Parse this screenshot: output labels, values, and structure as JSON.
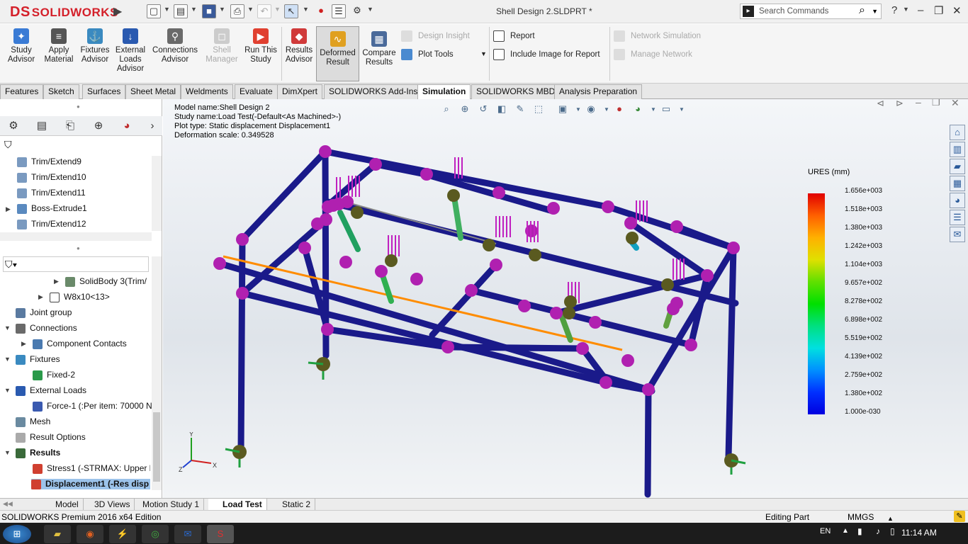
{
  "app": {
    "brand": "SOLIDWORKS",
    "brand_prefix": "DS",
    "window_title": "Shell Design 2.SLDPRT *",
    "search_placeholder": "Search Commands",
    "help_label": "?"
  },
  "commands": [
    {
      "label": "Study\nAdvisor",
      "icon": "study-advisor-icon",
      "color": "#3a7bd5"
    },
    {
      "label": "Apply\nMaterial",
      "icon": "apply-material-icon",
      "color": "#555555"
    },
    {
      "label": "Fixtures\nAdvisor",
      "icon": "fixtures-advisor-icon",
      "color": "#3a8ac0"
    },
    {
      "label": "External\nLoads\nAdvisor",
      "icon": "external-loads-icon",
      "color": "#2a5ab0"
    },
    {
      "label": "Connections\nAdvisor",
      "icon": "connections-advisor-icon",
      "color": "#6a6a6a"
    },
    {
      "label": "Shell\nManager",
      "icon": "shell-manager-icon",
      "color": "#cccccc",
      "disabled": true
    },
    {
      "label": "Run This\nStudy",
      "icon": "run-study-icon",
      "color": "#e04030"
    },
    {
      "label": "Results\nAdvisor",
      "icon": "results-advisor-icon",
      "color": "#d03a3a"
    },
    {
      "label": "Deformed\nResult",
      "icon": "deformed-result-icon",
      "color": "#e0a020"
    },
    {
      "label": "Compare\nResults",
      "icon": "compare-results-icon",
      "color": "#4a6a9a"
    }
  ],
  "side_commands": {
    "design_insight": "Design Insight",
    "plot_tools": "Plot Tools",
    "report": "Report",
    "include_image": "Include Image for Report",
    "network_sim": "Network Simulation",
    "manage_network": "Manage Network"
  },
  "tabs": [
    "Features",
    "Sketch",
    "Surfaces",
    "Sheet Metal",
    "Weldments",
    "Evaluate",
    "DimXpert",
    "SOLIDWORKS Add-Ins",
    "Simulation",
    "SOLIDWORKS MBD",
    "Analysis Preparation"
  ],
  "active_tab": "Simulation",
  "tree_top": [
    "Trim/Extend9",
    "Trim/Extend10",
    "Trim/Extend11",
    "Boss-Extrude1",
    "Trim/Extend12"
  ],
  "tree_bottom": {
    "solidbody": "SolidBody 3(Trim/",
    "w8x10": "W8x10<13>",
    "joint_group": "Joint group",
    "connections": "Connections",
    "component_contacts": "Component Contacts",
    "fixtures": "Fixtures",
    "fixed2": "Fixed-2",
    "external_loads": "External Loads",
    "force1": "Force-1 (:Per item: 70000 N",
    "mesh": "Mesh",
    "result_options": "Result Options",
    "results": "Results",
    "stress1": "Stress1 (-STRMAX: Upper b",
    "displacement1": "Displacement1 (-Res disp"
  },
  "model_info": {
    "model_name": "Model name:Shell Design 2",
    "study_name": "Study name:Load Test(-Default<As Machined>-)",
    "plot_type": "Plot type: Static displacement Displacement1",
    "deformation_scale": "Deformation scale: 0.349528"
  },
  "legend": {
    "title": "URES (mm)",
    "ticks": [
      "1.656e+003",
      "1.518e+003",
      "1.380e+003",
      "1.242e+003",
      "1.104e+003",
      "9.657e+002",
      "8.278e+002",
      "6.898e+002",
      "5.519e+002",
      "4.139e+002",
      "2.759e+002",
      "1.380e+002",
      "1.000e-030"
    ]
  },
  "triad": {
    "x": "X",
    "y": "Y",
    "z": "Z"
  },
  "bottom_tabs": [
    "Model",
    "3D Views",
    "Motion Study 1",
    "Load Test",
    "Static 2"
  ],
  "active_bottom_tab": "Load Test",
  "status": {
    "edition": "SOLIDWORKS Premium 2016 x64 Edition",
    "editing": "Editing Part",
    "units": "MMGS"
  },
  "taskbar": {
    "lang": "EN",
    "time": "11:14 AM"
  },
  "colors": {
    "beam": "#1a1a8a",
    "node": "#b020b0",
    "fixture": "#5a5a20",
    "orange_line": "#ff8c00",
    "accent": "#d4202a"
  }
}
